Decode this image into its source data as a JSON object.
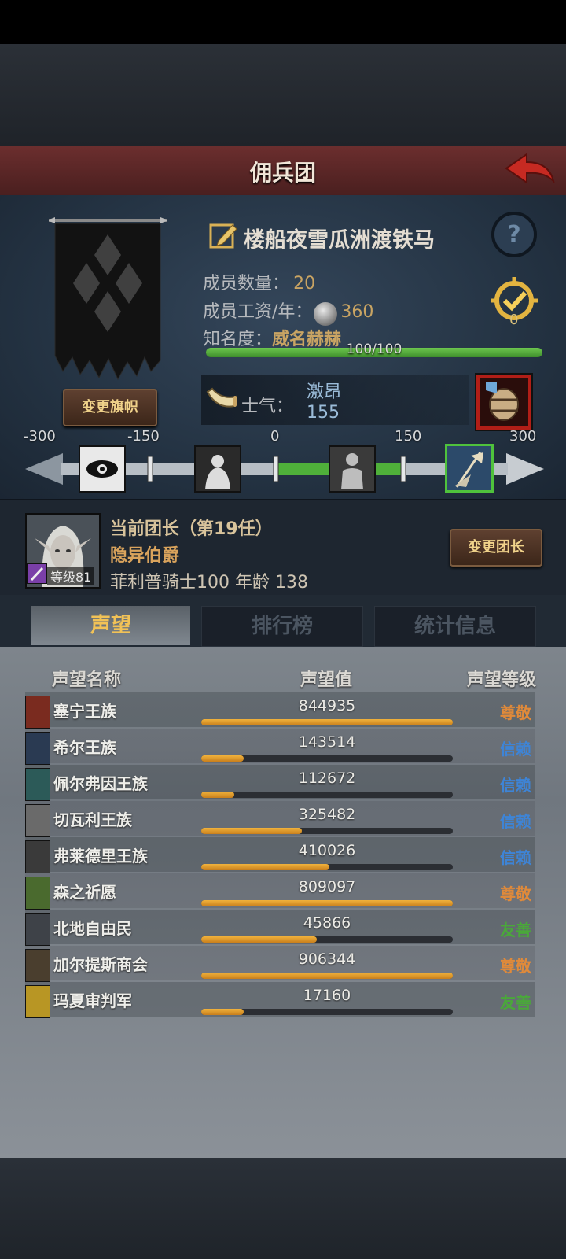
{
  "header": {
    "title": "佣兵团"
  },
  "guild": {
    "name": "楼船夜雪瓜洲渡铁马",
    "change_banner_label": "变更旗帜",
    "members_label": "成员数量：",
    "members_value": "20",
    "wage_label": "成员工资/年：",
    "wage_value": "360",
    "fame_label": "知名度：",
    "fame_value": "威名赫赫",
    "fame_progress_text": "100/100",
    "fame_progress": 1.0,
    "task_count": "0"
  },
  "morale": {
    "label": "士气：",
    "state": "激昂",
    "value": "155",
    "ticks": [
      "-300",
      "-150",
      "0",
      "150",
      "300"
    ],
    "icons": [
      "evil-eye-icon",
      "hunched-figure-icon",
      "calm-figure-icon",
      "charging-flag-icon"
    ]
  },
  "leader": {
    "heading": "当前团长（第19任）",
    "title": "隐异伯爵",
    "info": "菲利普骑士100  年龄 138",
    "level": "等级81",
    "change_leader_label": "变更团长"
  },
  "tabs": [
    {
      "label": "声望",
      "active": true
    },
    {
      "label": "排行榜",
      "active": false
    },
    {
      "label": "统计信息",
      "active": false
    }
  ],
  "reputation": {
    "columns": [
      "声望名称",
      "声望值",
      "声望等级"
    ],
    "rows": [
      {
        "name": "塞宁王族",
        "value": "844935",
        "level": "尊敬",
        "fill": 1.0,
        "level_color": "#e08a3a",
        "icon_color": "#7a2b1f"
      },
      {
        "name": "希尔王族",
        "value": "143514",
        "level": "信赖",
        "fill": 0.17,
        "level_color": "#3e84d6",
        "icon_color": "#2a3a52"
      },
      {
        "name": "佩尔弗因王族",
        "value": "112672",
        "level": "信赖",
        "fill": 0.13,
        "level_color": "#3e84d6",
        "icon_color": "#2c5a58"
      },
      {
        "name": "切瓦利王族",
        "value": "325482",
        "level": "信赖",
        "fill": 0.4,
        "level_color": "#3e84d6",
        "icon_color": "#6a6a6a"
      },
      {
        "name": "弗莱德里王族",
        "value": "410026",
        "level": "信赖",
        "fill": 0.51,
        "level_color": "#3e84d6",
        "icon_color": "#3a3a3a"
      },
      {
        "name": "森之祈愿",
        "value": "809097",
        "level": "尊敬",
        "fill": 1.0,
        "level_color": "#e08a3a",
        "icon_color": "#4a6a2e"
      },
      {
        "name": "北地自由民",
        "value": "45866",
        "level": "友善",
        "fill": 0.46,
        "level_color": "#4aa83a",
        "icon_color": "#3e4248"
      },
      {
        "name": "加尔提斯商会",
        "value": "906344",
        "level": "尊敬",
        "fill": 1.0,
        "level_color": "#e08a3a",
        "icon_color": "#4a3e2e"
      },
      {
        "name": "玛夏审判军",
        "value": "17160",
        "level": "友善",
        "fill": 0.17,
        "level_color": "#4aa83a",
        "icon_color": "#b89624"
      }
    ]
  }
}
